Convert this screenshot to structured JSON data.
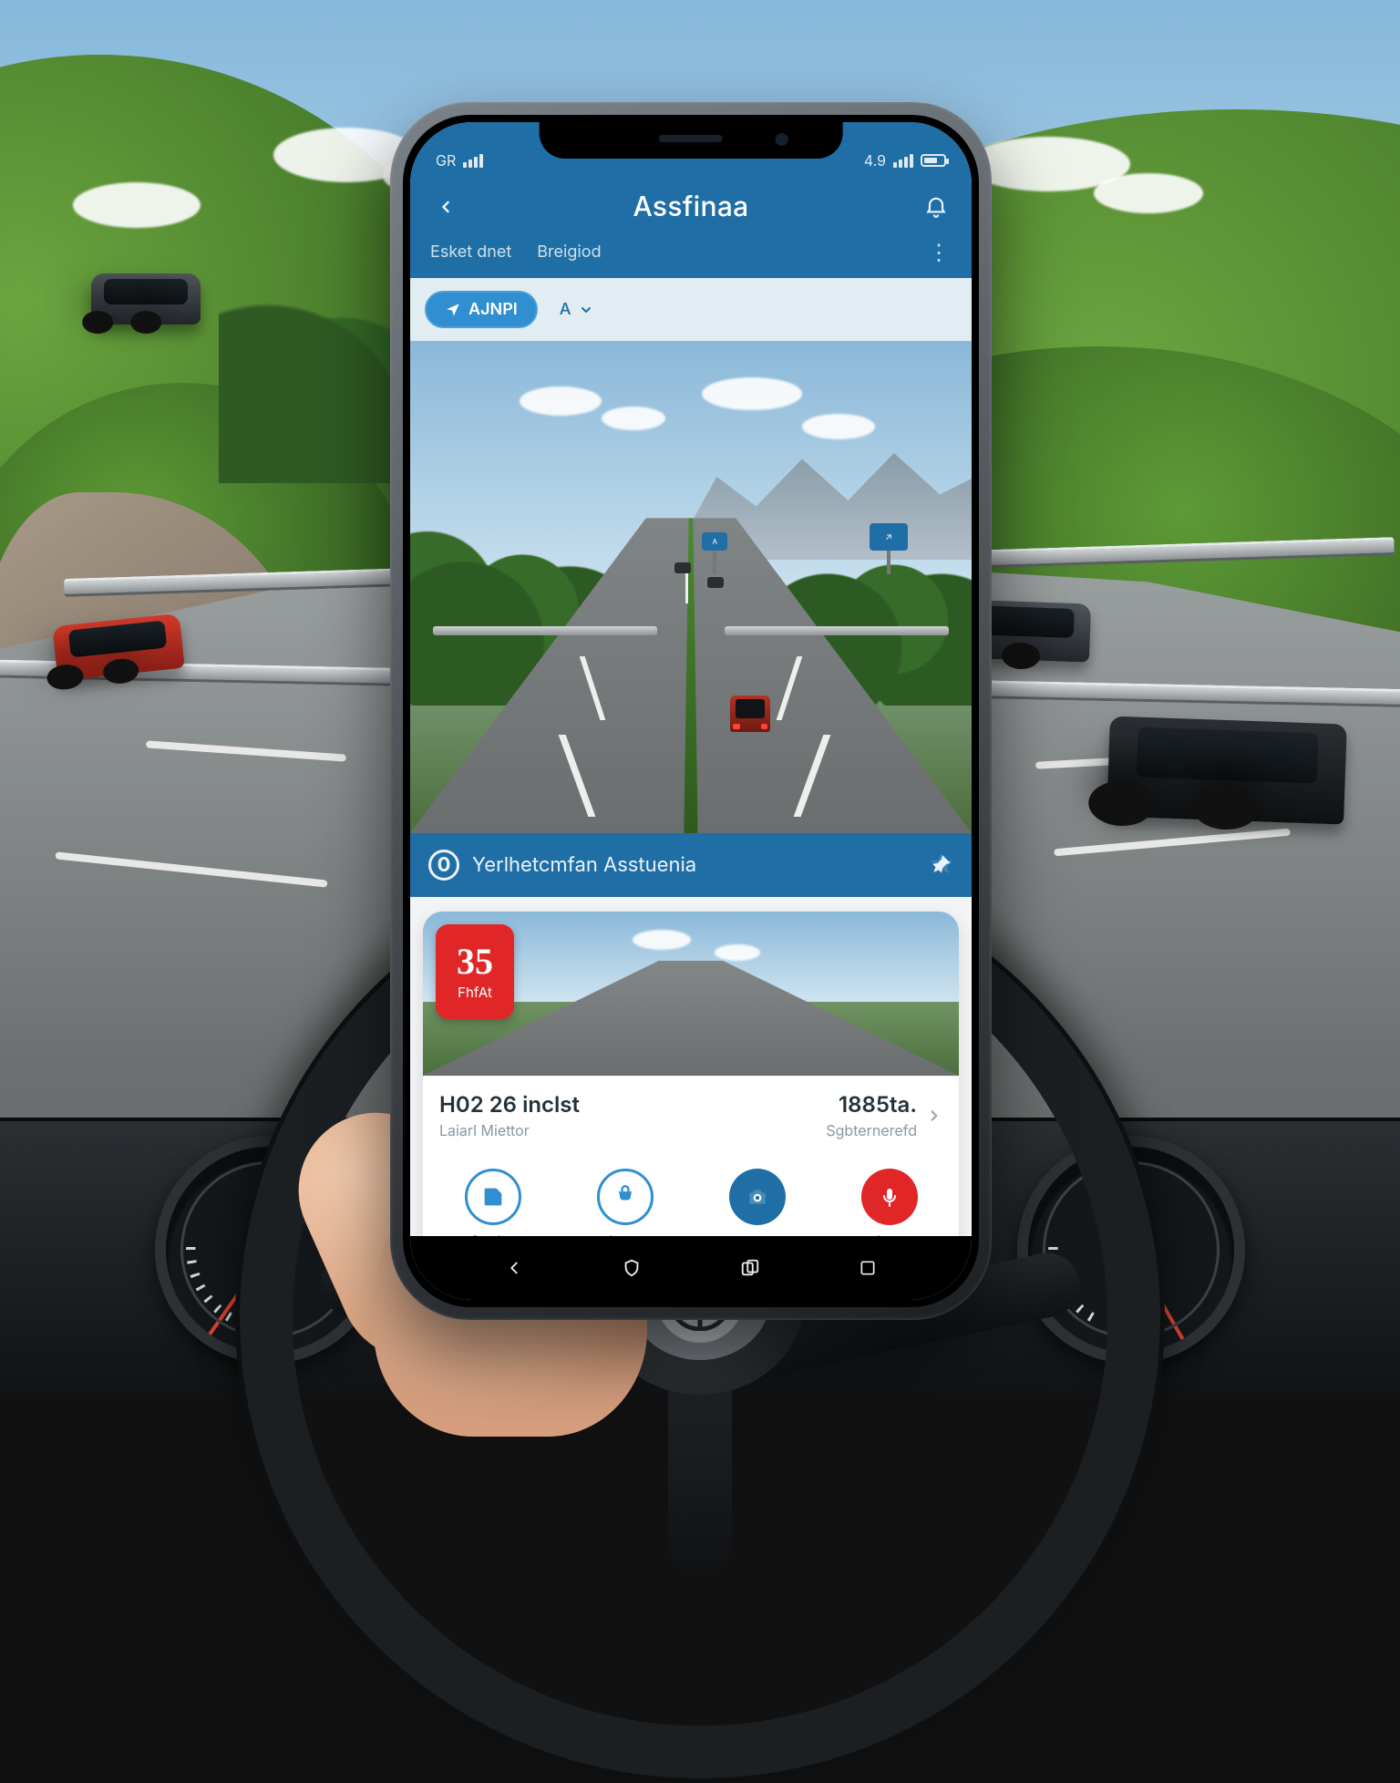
{
  "status_bar": {
    "carrier": "GR",
    "right_text": "4.9"
  },
  "header": {
    "title": "Assfinaa",
    "tabs": [
      "Esket dnet",
      "Breigiod"
    ]
  },
  "chips": {
    "primary": "AJNPI",
    "secondary": "A"
  },
  "banner": {
    "text": "Yerlhetcmfan Asstuenia",
    "info_glyph": "0"
  },
  "card": {
    "badge_number": "35",
    "badge_label": "FhfAt",
    "title": "H02 26 inclst",
    "subtitle": "Laiarl Miettor",
    "metric_value": "1885ta.",
    "metric_label": "Sgbternerefd"
  },
  "actions": [
    {
      "label": "fwrtire"
    },
    {
      "label": "Rislensl"
    },
    {
      "label": "Ascrat"
    },
    {
      "label": "idtc"
    }
  ]
}
